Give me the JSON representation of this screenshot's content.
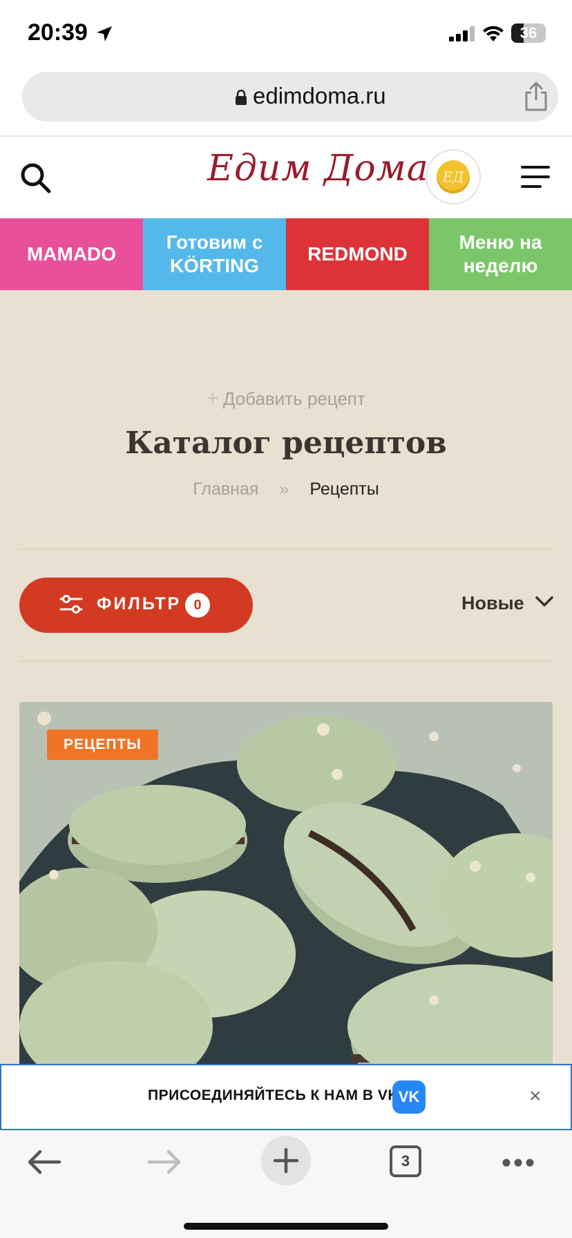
{
  "status_bar": {
    "time": "20:39",
    "battery_level": "36",
    "battery_fraction": 0.36
  },
  "browser": {
    "url": "edimdoma.ru",
    "open_tabs": "3"
  },
  "header": {
    "logo_text": "Едим Дома",
    "brand_color": "#9b1b2c",
    "coin_text": "ЕД"
  },
  "categories": [
    {
      "label": "MAMADO",
      "color": "#e8509a"
    },
    {
      "label": "Готовим с KÖRTING",
      "color": "#55b8ea"
    },
    {
      "label": "REDMOND",
      "color": "#dc3438"
    },
    {
      "label": "Меню на неделю",
      "color": "#7cc66a"
    }
  ],
  "main": {
    "add_recipe": "Добавить рецепт",
    "title": "Каталог рецептов",
    "breadcrumb": {
      "home": "Главная",
      "separator": "»",
      "current": "Рецепты"
    },
    "filter": {
      "label": "ФИЛЬТР",
      "count": "0"
    },
    "sort_label": "Новые",
    "card": {
      "tag": "РЕЦЕПТЫ",
      "image": "green-matcha-macarons-photo"
    }
  },
  "vk_banner": {
    "text": "ПРИСОЕДИНЯЙТЕСЬ К НАМ В VK!",
    "logo_text": "VK",
    "close": "×"
  },
  "colors": {
    "accent": "#d23a22",
    "page_bg": "#e8e0d0",
    "tag": "#ef7426"
  }
}
